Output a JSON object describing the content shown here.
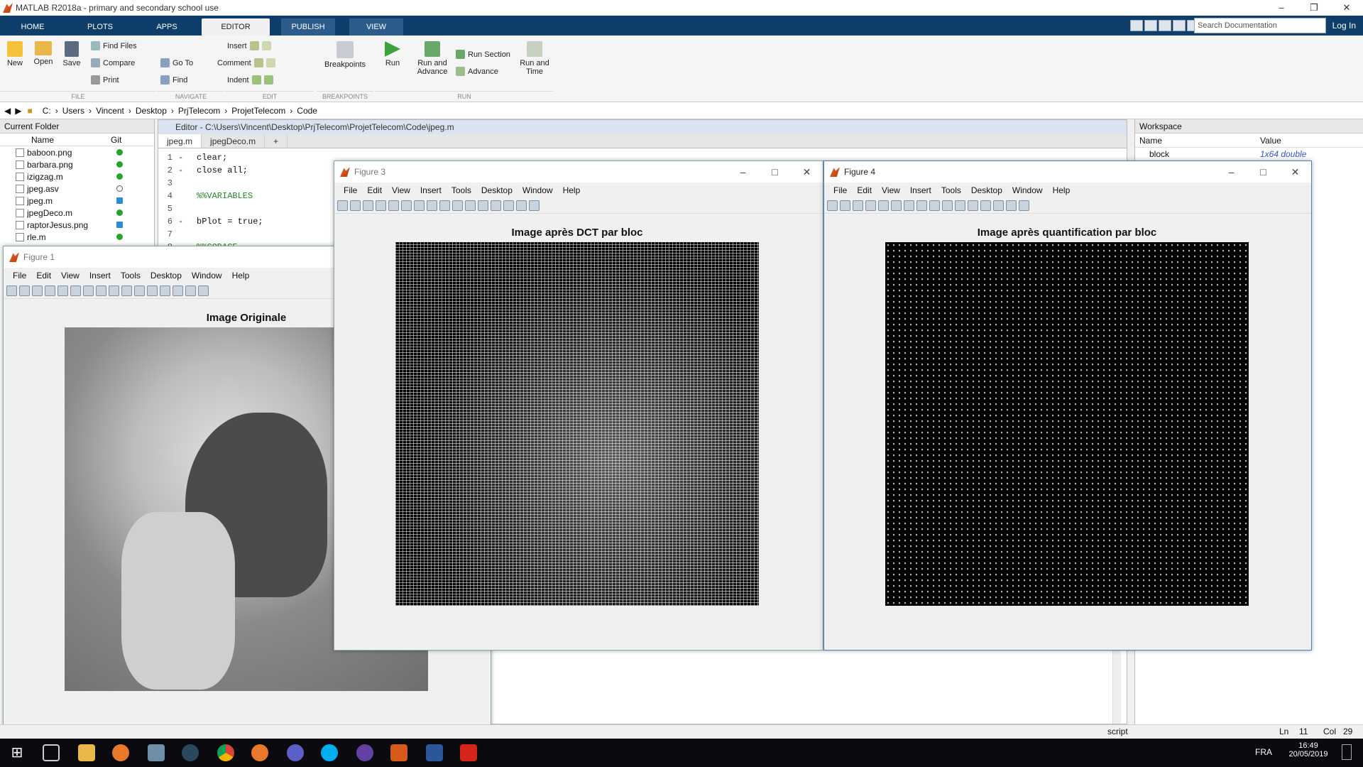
{
  "window": {
    "title": "MATLAB R2018a - primary and secondary school use"
  },
  "ribbon_tabs": [
    {
      "label": "HOME"
    },
    {
      "label": "PLOTS"
    },
    {
      "label": "APPS"
    },
    {
      "label": "EDITOR"
    },
    {
      "label": "PUBLISH"
    },
    {
      "label": "VIEW"
    }
  ],
  "search_placeholder": "Search Documentation",
  "login_label": "Log In",
  "ribbon": {
    "file": {
      "section": "FILE",
      "new": "New",
      "open": "Open",
      "save": "Save",
      "find_files": "Find Files",
      "compare": "Compare",
      "print": "Print"
    },
    "navigate": {
      "section": "NAVIGATE",
      "go_to": "Go To",
      "find": "Find"
    },
    "edit": {
      "section": "EDIT",
      "insert": "Insert",
      "comment": "Comment",
      "indent": "Indent"
    },
    "breakpoints": {
      "section": "BREAKPOINTS",
      "label": "Breakpoints"
    },
    "run": {
      "section": "RUN",
      "run": "Run",
      "run_advance": "Run and Advance",
      "run_section": "Run Section",
      "advance": "Advance",
      "run_time": "Run and Time"
    }
  },
  "address": [
    "C:",
    "Users",
    "Vincent",
    "Desktop",
    "PrjTelecom",
    "ProjetTelecom",
    "Code"
  ],
  "current_folder": {
    "title": "Current Folder",
    "col_name": "Name",
    "col_git": "Git",
    "files": [
      {
        "name": "baboon.png",
        "git": "#2aa12a"
      },
      {
        "name": "barbara.png",
        "git": "#2aa12a"
      },
      {
        "name": "izigzag.m",
        "git": "#2aa12a"
      },
      {
        "name": "jpeg.asv",
        "git": "#ffffff"
      },
      {
        "name": "jpeg.m",
        "git": "#2a8bd6"
      },
      {
        "name": "jpegDeco.m",
        "git": "#2aa12a"
      },
      {
        "name": "raptorJesus.png",
        "git": "#2a8bd6"
      },
      {
        "name": "rle.m",
        "git": "#2aa12a"
      }
    ]
  },
  "editor": {
    "path": "Editor - C:\\Users\\Vincent\\Desktop\\PrjTelecom\\ProjetTelecom\\Code\\jpeg.m",
    "tabs": [
      {
        "label": "jpeg.m"
      },
      {
        "label": "jpegDeco.m"
      },
      {
        "label": "+"
      }
    ],
    "lines": [
      {
        "n": "1",
        "t": "clear;"
      },
      {
        "n": "2",
        "t": "close all;"
      },
      {
        "n": "3",
        "t": ""
      },
      {
        "n": "4",
        "t": "%%VARIABLES"
      },
      {
        "n": "5",
        "t": ""
      },
      {
        "n": "6",
        "t": "bPlot = true;"
      },
      {
        "n": "7",
        "t": ""
      },
      {
        "n": "8",
        "t": "%%CODAGE"
      }
    ]
  },
  "workspace": {
    "title": "Workspace",
    "col_name": "Name",
    "col_value": "Value",
    "row": {
      "name": "block",
      "value": "1x64 double"
    }
  },
  "status": {
    "mode": "script",
    "ln_label": "Ln",
    "ln": "11",
    "col_label": "Col",
    "col": "29"
  },
  "figures": {
    "fig1": {
      "title": "Figure 1",
      "axis_title": "Image Originale"
    },
    "fig3": {
      "title": "Figure 3",
      "axis_title": "Image après DCT par bloc"
    },
    "fig4": {
      "title": "Figure 4",
      "axis_title": "Image après quantification par bloc"
    },
    "menu": [
      "File",
      "Edit",
      "View",
      "Insert",
      "Tools",
      "Desktop",
      "Window",
      "Help"
    ]
  },
  "taskbar": {
    "lang": "FRA",
    "time": "16:49",
    "date": "20/05/2019"
  }
}
